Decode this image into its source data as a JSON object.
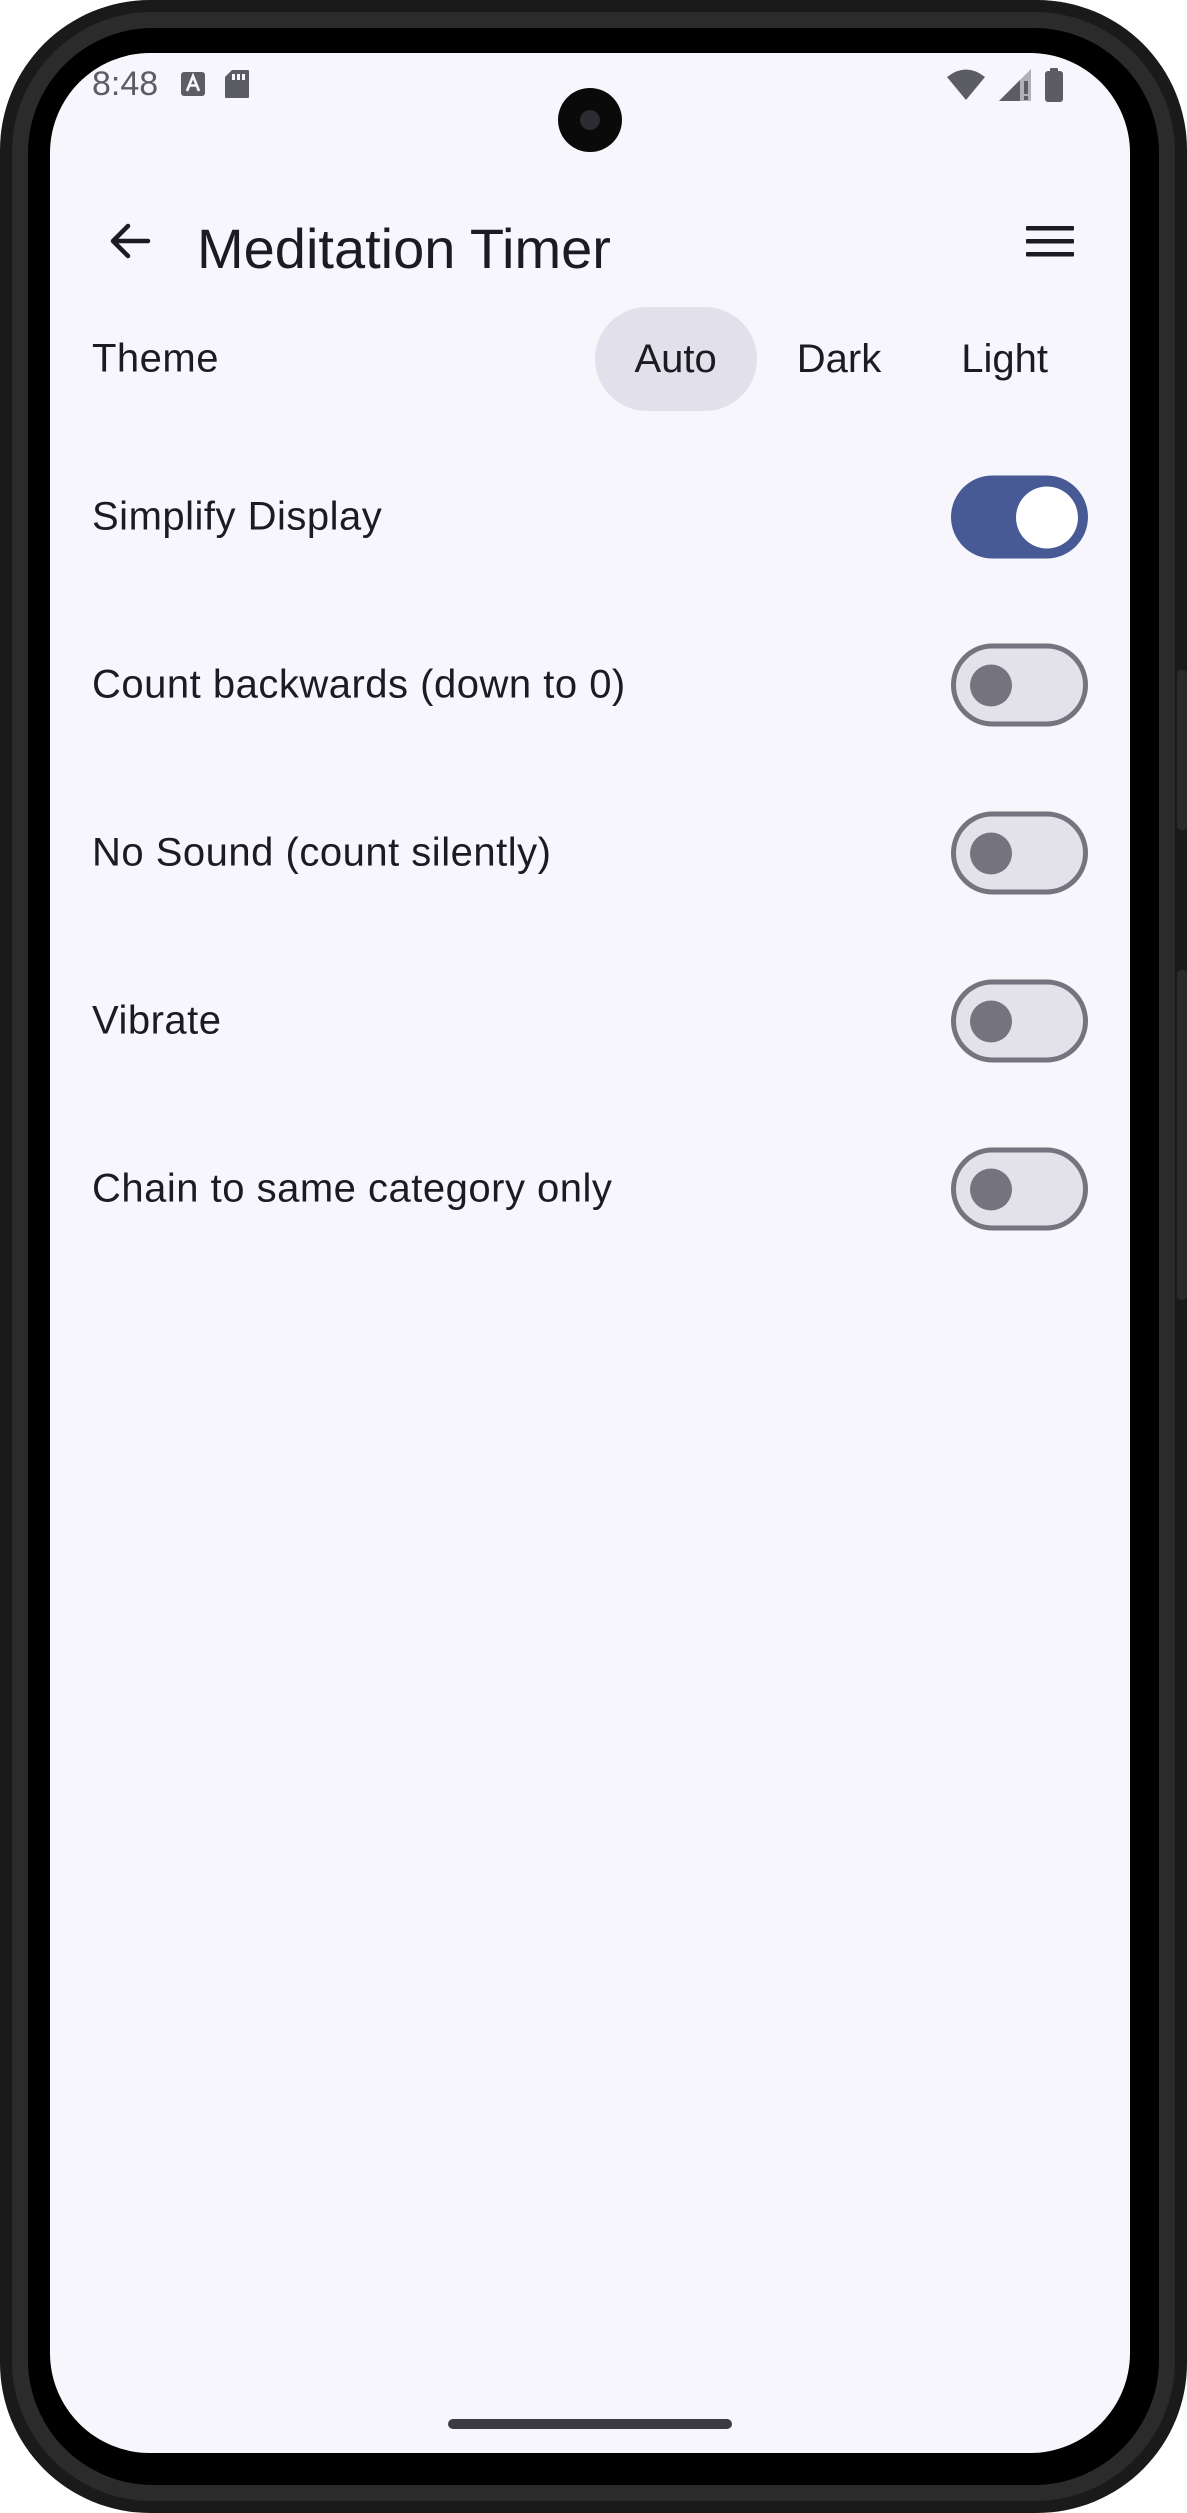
{
  "status_bar": {
    "time": "8:48",
    "left_icons": [
      "text-a-icon",
      "sd-card-icon"
    ],
    "right_icons": [
      "wifi-icon",
      "signal-icon",
      "battery-icon"
    ]
  },
  "app_bar": {
    "title": "Meditation Timer",
    "back_icon": "arrow-back-icon",
    "menu_icon": "hamburger-menu-icon"
  },
  "settings": {
    "theme": {
      "label": "Theme",
      "options": [
        "Auto",
        "Dark",
        "Light"
      ],
      "selected": "Auto"
    },
    "toggles": [
      {
        "label": "Simplify Display",
        "on": true
      },
      {
        "label": "Count backwards (down to 0)",
        "on": false
      },
      {
        "label": "No Sound (count silently)",
        "on": false
      },
      {
        "label": "Vibrate",
        "on": false
      },
      {
        "label": "Chain to same category only",
        "on": false
      }
    ]
  },
  "colors": {
    "background": "#f7f6fc",
    "switch_on": "#475a95",
    "switch_off_track": "#e3e2eb",
    "switch_off_outline": "#75747e",
    "segment_selected": "#e2e1eb",
    "text": "#1b1b21"
  }
}
